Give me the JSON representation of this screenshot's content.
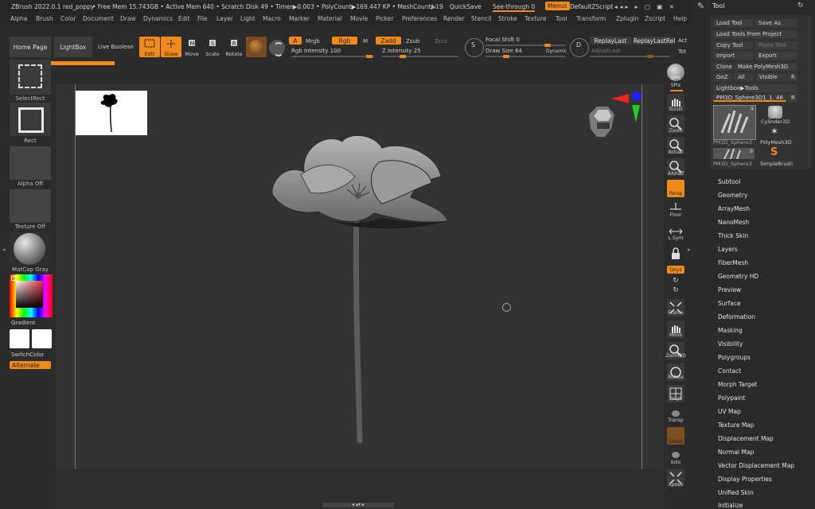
{
  "titlebar": {
    "app": "ZBrush 2022.0.1 red_poppy",
    "stats": "• Free Mem 15.743GB • Active Mem 640 • Scratch Disk 49 • Timer▶0.003 • PolyCount▶169.447 KP • MeshCount▶19",
    "ac": "AC",
    "quicksave": "QuickSave",
    "seethrough": "See-through  0",
    "menus": "Menus",
    "script": "DefaultZScript"
  },
  "menu": [
    "Alpha",
    "Brush",
    "Color",
    "Document",
    "Draw",
    "Dynamics",
    "Edit",
    "File",
    "Layer",
    "Light",
    "Macro",
    "Marker",
    "Material",
    "Movie",
    "Picker",
    "Preferences",
    "Render",
    "Stencil",
    "Stroke",
    "Texture",
    "Tool",
    "Transform",
    "Zplugin",
    "Zscript",
    "Help"
  ],
  "shelf": {
    "home": "Home Page",
    "lightbox": "LightBox",
    "liveboolean": "Live Boolean",
    "edit": "Edit",
    "draw": "Draw",
    "move": "Move",
    "scale": "Scale",
    "rotate": "Rotate",
    "a": "A",
    "mrgb": "Mrgb",
    "rgb": "Rgb",
    "m": "M",
    "zadd": "Zadd",
    "zsub": "Zsub",
    "zcut": "Zcut",
    "rgb_intensity": "Rgb Intensity 100",
    "z_intensity": "Z Intensity 25",
    "focal_shift": "Focal Shift 0",
    "draw_size": "Draw Size 64",
    "dynamic": "Dynamic",
    "replaylast": "ReplayLast",
    "replaylastrel": "ReplayLastRel",
    "act": "Act",
    "adjustlast": "AdjustLast",
    "tot": "Tot"
  },
  "left": {
    "selectrect": "SelectRect",
    "rect": "Rect",
    "alpha": "Alpha Off",
    "texture": "Texture Off",
    "matcap": "MatCap Gray",
    "gradient": "Gradient",
    "switchcolor": "SwitchColor",
    "alternate": "Alternate"
  },
  "right": {
    "bpr": "BPR",
    "spix": "SPix",
    "scroll": "Scroll",
    "zoom": "Zoom",
    "actual": "Actual",
    "aahalf": "AAHalf",
    "persp": "Persp",
    "floor": "Floor",
    "lsym": "L.Sym",
    "xyz": "Qxyz",
    "frame": "Frame",
    "move": "Move",
    "zoom3d": "Zoom3D",
    "rotate": "Rotate",
    "polyf": "PolyF",
    "transp": "Transp",
    "ghost": "Ghost",
    "solo": "Solo",
    "xpose": "Xpose"
  },
  "tool": {
    "title": "Tool",
    "load": "Load Tool",
    "saveas": "Save As",
    "loadproject": "Load Tools From Project",
    "copy": "Copy Tool",
    "paste": "Paste Tool",
    "import": "Import",
    "export": "Export",
    "clone": "Clone",
    "makepoly": "Make PolyMesh3D",
    "goz": "GoZ",
    "all": "All",
    "visible": "Visible",
    "r": "R",
    "lightboxtools": "Lightbox▶Tools",
    "current": "PM3D_Sphere3D1_1. 48",
    "thumbs": [
      {
        "label": "PM3D_Sphere3",
        "count": "9"
      },
      {
        "label": "Cylinder3D",
        "count": ""
      },
      {
        "label": "PM3D_Sphere3",
        "count": ""
      },
      {
        "label": "PolyMesh3D",
        "count": ""
      },
      {
        "label": "PM3D_Sphere3",
        "count": "9"
      },
      {
        "label": "SimpleBrush",
        "count": ""
      }
    ],
    "subpalettes": [
      "Subtool",
      "Geometry",
      "ArrayMesh",
      "NanoMesh",
      "Thick Skin",
      "Layers",
      "FiberMesh",
      "Geometry HD",
      "Preview",
      "Surface",
      "Deformation",
      "Masking",
      "Visibility",
      "Polygroups",
      "Contact",
      "Morph Target",
      "Polypaint",
      "UV Map",
      "Texture Map",
      "Displacement Map",
      "Normal Map",
      "Vector Displacement Map",
      "Display Properties",
      "Unified Skin",
      "Initialize"
    ]
  },
  "colors": {
    "accent": "#f08a1a",
    "bg": "#2b2b2b",
    "canvas": "#333333"
  }
}
